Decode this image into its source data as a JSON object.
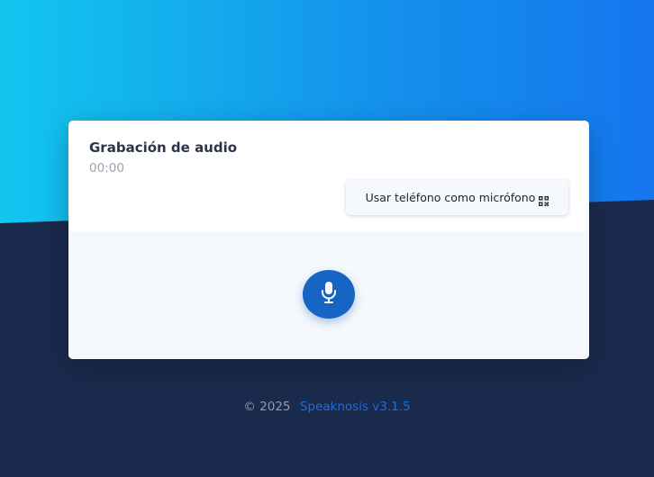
{
  "recorder": {
    "title": "Grabación de audio",
    "timer": "00:00",
    "phone_button_label": "Usar teléfono como micrófono",
    "phone_button_icon": "qr-code-icon",
    "mic_button_icon": "microphone-icon"
  },
  "footer": {
    "copyright": "© 2025",
    "app_link": "Speaknosis v3.1.5"
  },
  "colors": {
    "gradient_start": "#13c6ee",
    "gradient_end": "#1576ee",
    "background_dark": "#1a2a4d",
    "accent": "#1765c2"
  }
}
